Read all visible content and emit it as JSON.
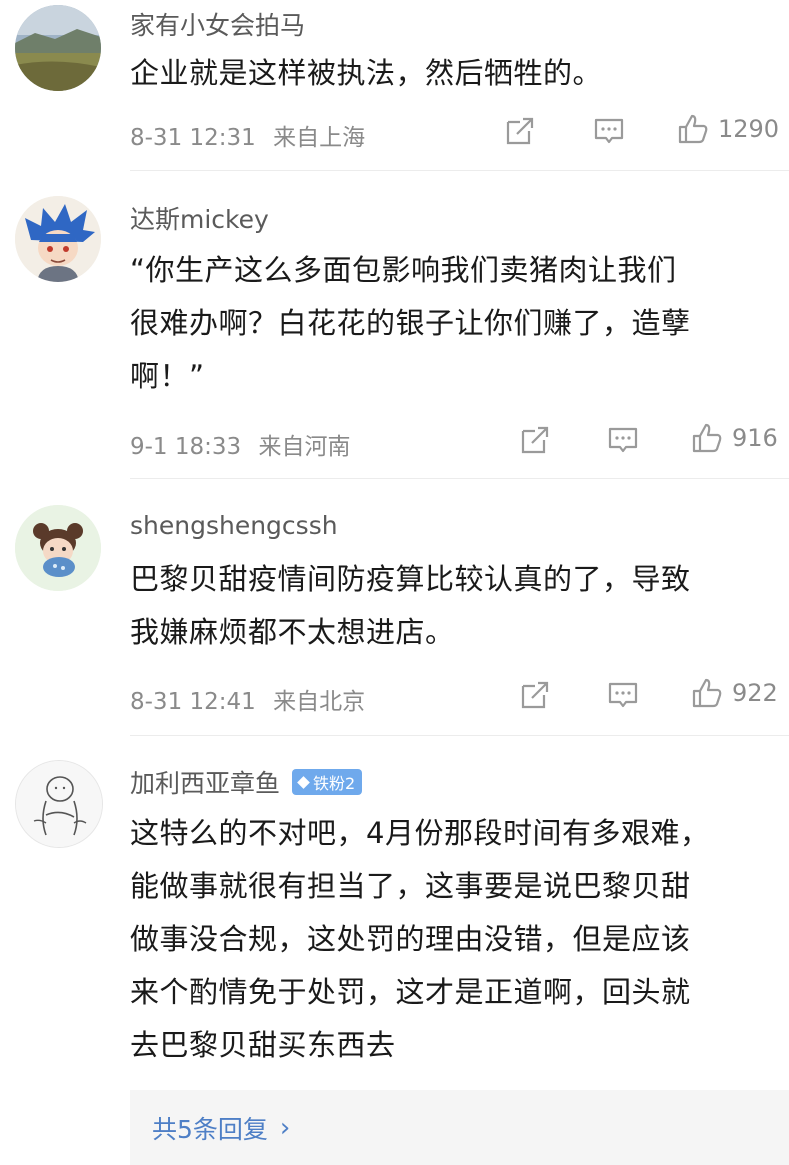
{
  "comments": [
    {
      "username": "家有小女会拍马",
      "content": "企业就是这样被执法，然后牺牲的。",
      "date": "8-31 12:31",
      "location": "来自上海",
      "likes": "1290"
    },
    {
      "username": "达斯mickey",
      "content": "“你生产这么多面包影响我们卖猪肉让我们\n很难办啊？白花花的银子让你们赚了，造孽\n啊！”",
      "date": "9-1 18:33",
      "location": "来自河南",
      "likes": "916"
    },
    {
      "username": "shengshengcssh",
      "content": "巴黎贝甜疫情间防疫算比较认真的了，导致\n我嫌麻烦都不太想进店。",
      "date": "8-31 12:41",
      "location": "来自北京",
      "likes": "922"
    },
    {
      "username": "加利西亚章鱼",
      "badge": "铁粉2",
      "content": "这特么的不对吧，4月份那段时间有多艰难，\n能做事就很有担当了，这事要是说巴黎贝甜\n做事没合规，这处罚的理由没错，但是应该\n来个酌情免于处罚，这才是正道啊，回头就\n去巴黎贝甜买东西去"
    }
  ],
  "replies": {
    "label": "共5条回复",
    "icon": "chevron-right-icon"
  },
  "colors": {
    "badge": "#6fa9ec",
    "link": "#4e7fc6",
    "meta": "#8a8a8a"
  }
}
